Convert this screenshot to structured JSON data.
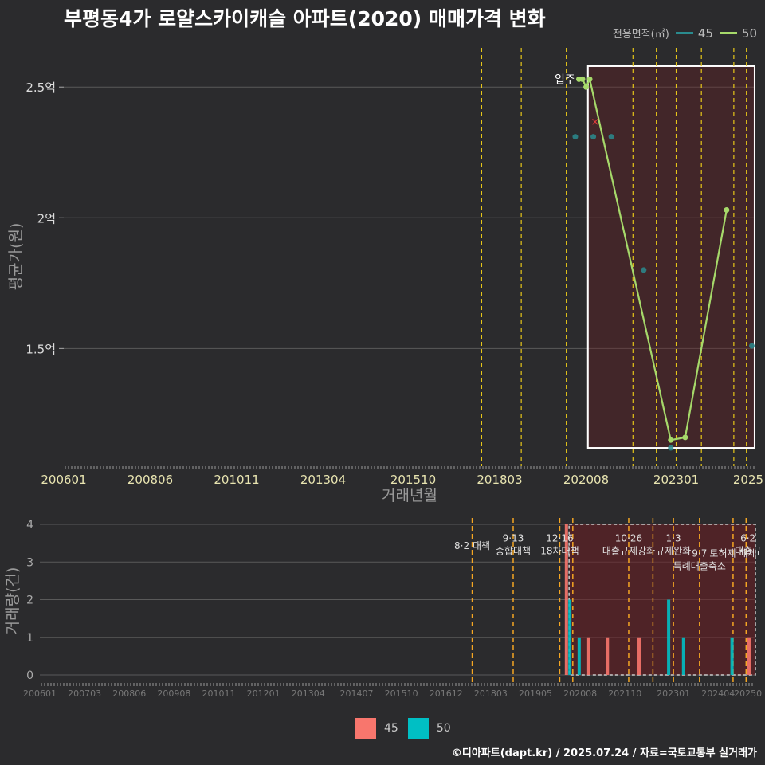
{
  "title": "부평동4가 로얄스카이캐슬 아파트(2020) 매매가격 변화",
  "legend_title": "전용면적(㎡)",
  "footer": "©디아파트(dapt.kr) / 2025.07.24 / 자료=국토교통부 실거래가",
  "colors": {
    "s45": "#f8766d",
    "s50": "#00bfc4",
    "line45": "#2a8b8e",
    "line50": "#a6d96a",
    "grid": "#5a5a5a",
    "vline": "#e6c619",
    "vline_orange": "#f5a623",
    "box": "#ffffff"
  },
  "chart_data": [
    {
      "type": "line",
      "ylabel": "평균가(원)",
      "xlabel": "거래년월",
      "ylim": [
        1.05,
        2.65
      ],
      "xlim": [
        2006.0,
        2025.2
      ],
      "y_ticks": [
        {
          "v": 1.5,
          "label": "1.5억"
        },
        {
          "v": 2.0,
          "label": "2억"
        },
        {
          "v": 2.5,
          "label": "2.5억"
        }
      ],
      "x_ticks": [
        {
          "v": 2006.0,
          "label": "200601"
        },
        {
          "v": 2008.4,
          "label": "200806"
        },
        {
          "v": 2010.8,
          "label": "201011"
        },
        {
          "v": 2013.2,
          "label": "201304"
        },
        {
          "v": 2015.7,
          "label": "201510"
        },
        {
          "v": 2018.1,
          "label": "201803"
        },
        {
          "v": 2020.5,
          "label": "202008"
        },
        {
          "v": 2023.0,
          "label": "202301"
        },
        {
          "v": 2025.0,
          "label": "2025"
        }
      ],
      "annotation": {
        "label": "입주",
        "x": 2020.0,
        "y": 2.53
      },
      "highlight_box": {
        "x0": 2020.55,
        "x1": 2025.0,
        "y0": 1.12,
        "y1": 2.58
      },
      "vlines": [
        2017.6,
        2018.7,
        2019.95,
        2021.8,
        2022.45,
        2023.0,
        2023.7,
        2024.6,
        2024.95
      ],
      "series": [
        {
          "name": "45",
          "points": [
            {
              "x": 2020.2,
              "y": 2.31
            },
            {
              "x": 2020.7,
              "y": 2.31
            },
            {
              "x": 2021.2,
              "y": 2.31
            },
            {
              "x": 2022.1,
              "y": 1.8
            },
            {
              "x": 2022.85,
              "y": 1.12
            },
            {
              "x": 2025.1,
              "y": 1.51
            }
          ]
        },
        {
          "name": "50",
          "points": [
            {
              "x": 2020.3,
              "y": 2.53
            },
            {
              "x": 2020.4,
              "y": 2.53
            },
            {
              "x": 2020.5,
              "y": 2.5
            },
            {
              "x": 2020.6,
              "y": 2.53
            },
            {
              "x": 2022.85,
              "y": 1.15
            },
            {
              "x": 2023.25,
              "y": 1.16
            },
            {
              "x": 2024.4,
              "y": 2.03
            }
          ]
        }
      ],
      "outlier": {
        "x": 2020.75,
        "y": 2.37,
        "label": "×"
      }
    },
    {
      "type": "bar",
      "ylabel": "거래량(건)",
      "ylim": [
        0,
        4
      ],
      "xlim": [
        2006.0,
        2025.2
      ],
      "y_ticks": [
        0,
        1,
        2,
        3,
        4
      ],
      "x_ticks": [
        {
          "v": 2006.0,
          "label": "200601"
        },
        {
          "v": 2007.2,
          "label": "200703"
        },
        {
          "v": 2008.4,
          "label": "200806"
        },
        {
          "v": 2009.6,
          "label": "200908"
        },
        {
          "v": 2010.8,
          "label": "201011"
        },
        {
          "v": 2012.0,
          "label": "201201"
        },
        {
          "v": 2013.2,
          "label": "201304"
        },
        {
          "v": 2014.5,
          "label": "201407"
        },
        {
          "v": 2015.7,
          "label": "201510"
        },
        {
          "v": 2016.9,
          "label": "201612"
        },
        {
          "v": 2018.1,
          "label": "201803"
        },
        {
          "v": 2019.3,
          "label": "201905"
        },
        {
          "v": 2020.5,
          "label": "202008"
        },
        {
          "v": 2021.7,
          "label": "202110"
        },
        {
          "v": 2023.0,
          "label": "202301"
        },
        {
          "v": 2024.2,
          "label": "202404"
        },
        {
          "v": 2025.0,
          "label": "20250"
        }
      ],
      "highlight_box": {
        "x0": 2020.2,
        "x1": 2025.2,
        "y0": 0,
        "y1": 4
      },
      "vlines": [
        {
          "x": 2017.6,
          "color": "orange"
        },
        {
          "x": 2018.7,
          "color": "orange"
        },
        {
          "x": 2019.95,
          "color": "orange"
        },
        {
          "x": 2020.3,
          "color": "orange"
        },
        {
          "x": 2021.8,
          "color": "orange"
        },
        {
          "x": 2022.45,
          "color": "orange"
        },
        {
          "x": 2023.0,
          "color": "orange"
        },
        {
          "x": 2023.7,
          "color": "orange"
        },
        {
          "x": 2024.6,
          "color": "orange"
        },
        {
          "x": 2024.95,
          "color": "orange"
        }
      ],
      "policy_labels": [
        {
          "x": 2017.6,
          "y": 3.6,
          "lines": [
            "8·2 대책"
          ]
        },
        {
          "x": 2018.7,
          "y": 3.8,
          "lines": [
            "9·13",
            "종합대책"
          ]
        },
        {
          "x": 2019.95,
          "y": 3.8,
          "lines": [
            "12·16",
            "18차대책"
          ]
        },
        {
          "x": 2021.8,
          "y": 3.8,
          "lines": [
            "10·26",
            "대출규제강화"
          ]
        },
        {
          "x": 2023.0,
          "y": 3.8,
          "lines": [
            "1·3",
            "규제완화"
          ]
        },
        {
          "x": 2023.7,
          "y": 3.4,
          "lines": [
            "9·7",
            "특례대출축소"
          ]
        },
        {
          "x": 2024.6,
          "y": 3.4,
          "lines": [
            "토허제 해제"
          ]
        },
        {
          "x": 2025.0,
          "y": 3.8,
          "lines": [
            "6·2",
            "대출규"
          ]
        }
      ],
      "series": [
        {
          "name": "45",
          "bars": [
            {
              "x": 2020.15,
              "v": 4
            },
            {
              "x": 2020.75,
              "v": 1
            },
            {
              "x": 2021.25,
              "v": 1
            },
            {
              "x": 2022.1,
              "v": 1
            },
            {
              "x": 2025.05,
              "v": 1
            }
          ]
        },
        {
          "name": "50",
          "bars": [
            {
              "x": 2020.2,
              "v": 2
            },
            {
              "x": 2020.45,
              "v": 1
            },
            {
              "x": 2022.85,
              "v": 2
            },
            {
              "x": 2023.25,
              "v": 1
            },
            {
              "x": 2024.55,
              "v": 1
            }
          ]
        }
      ]
    }
  ]
}
